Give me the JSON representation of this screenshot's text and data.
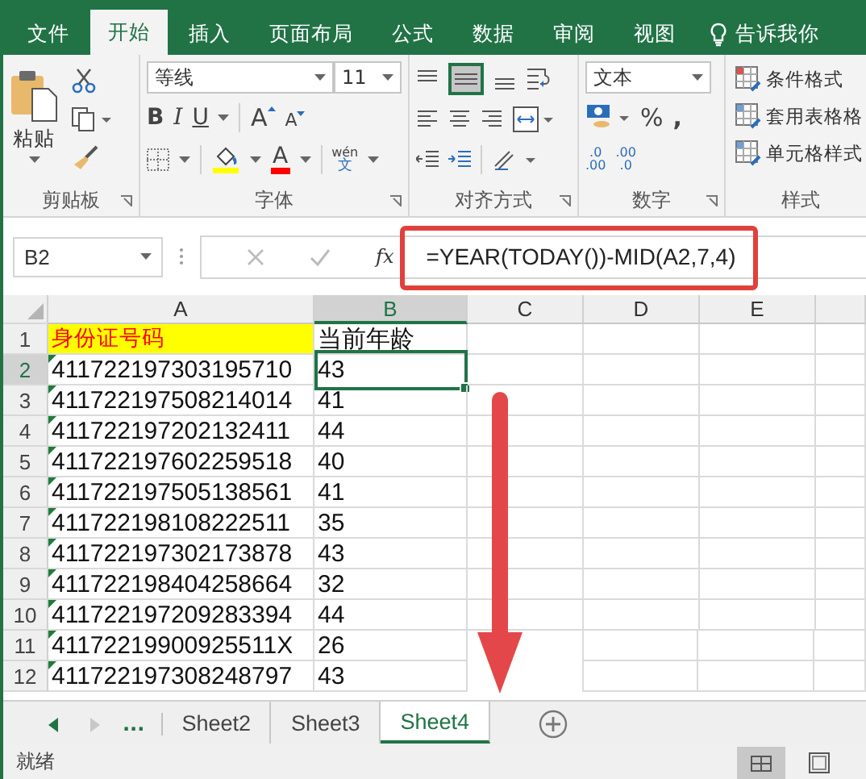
{
  "tabs": [
    {
      "label": "文件",
      "selected": false
    },
    {
      "label": "开始",
      "selected": true
    },
    {
      "label": "插入",
      "selected": false
    },
    {
      "label": "页面布局",
      "selected": false
    },
    {
      "label": "公式",
      "selected": false
    },
    {
      "label": "数据",
      "selected": false
    },
    {
      "label": "审阅",
      "selected": false
    },
    {
      "label": "视图",
      "selected": false
    }
  ],
  "tell_me": "告诉我你",
  "ribbon": {
    "clipboard": {
      "label": "剪贴板",
      "paste": "粘贴"
    },
    "font": {
      "label": "字体",
      "font_name": "等线",
      "font_size": "11",
      "bold": "B",
      "italic": "I",
      "underline": "U",
      "grow": "A",
      "shrink": "A",
      "font_color": "A",
      "phonetic": "wén",
      "phonetic_char": "文"
    },
    "alignment": {
      "label": "对齐方式"
    },
    "number": {
      "label": "数字",
      "format": "文本",
      "percent": "%",
      "comma": ",",
      "increase_decimal": [
        ".0",
        ".00"
      ],
      "decrease_decimal": [
        ".00",
        ".0"
      ]
    },
    "styles": {
      "label": "样式",
      "buttons": [
        "条件格式",
        "套用表格格",
        "单元格样式"
      ]
    }
  },
  "formula_bar": {
    "name_box": "B2",
    "fx": "fx",
    "formula": "=YEAR(TODAY())-MID(A2,7,4)"
  },
  "columns": [
    {
      "label": "A",
      "selected": false
    },
    {
      "label": "B",
      "selected": true
    },
    {
      "label": "C",
      "selected": false
    },
    {
      "label": "D",
      "selected": false
    },
    {
      "label": "E",
      "selected": false
    }
  ],
  "rows": [
    {
      "label": "1",
      "selected": false,
      "kind": "header",
      "cells": [
        {
          "text": "身份证号码",
          "selected": false,
          "text_number": false
        },
        {
          "text": "当前年龄",
          "selected": false,
          "text_number": false
        }
      ]
    },
    {
      "label": "2",
      "selected": true,
      "kind": "data",
      "cells": [
        {
          "text": "411722197303195710",
          "selected": false,
          "text_number": true
        },
        {
          "text": "43",
          "selected": true,
          "text_number": false
        }
      ]
    },
    {
      "label": "3",
      "selected": false,
      "kind": "data",
      "cells": [
        {
          "text": "411722197508214014",
          "selected": false,
          "text_number": true
        },
        {
          "text": "41",
          "selected": false,
          "text_number": false
        }
      ]
    },
    {
      "label": "4",
      "selected": false,
      "kind": "data",
      "cells": [
        {
          "text": "411722197202132411",
          "selected": false,
          "text_number": true
        },
        {
          "text": "44",
          "selected": false,
          "text_number": false
        }
      ]
    },
    {
      "label": "5",
      "selected": false,
      "kind": "data",
      "cells": [
        {
          "text": "411722197602259518",
          "selected": false,
          "text_number": true
        },
        {
          "text": "40",
          "selected": false,
          "text_number": false
        }
      ]
    },
    {
      "label": "6",
      "selected": false,
      "kind": "data",
      "cells": [
        {
          "text": "411722197505138561",
          "selected": false,
          "text_number": true
        },
        {
          "text": "41",
          "selected": false,
          "text_number": false
        }
      ]
    },
    {
      "label": "7",
      "selected": false,
      "kind": "data",
      "cells": [
        {
          "text": "411722198108222511",
          "selected": false,
          "text_number": true
        },
        {
          "text": "35",
          "selected": false,
          "text_number": false
        }
      ]
    },
    {
      "label": "8",
      "selected": false,
      "kind": "data",
      "cells": [
        {
          "text": "411722197302173878",
          "selected": false,
          "text_number": true
        },
        {
          "text": "43",
          "selected": false,
          "text_number": false
        }
      ]
    },
    {
      "label": "9",
      "selected": false,
      "kind": "data",
      "cells": [
        {
          "text": "411722198404258664",
          "selected": false,
          "text_number": true
        },
        {
          "text": "32",
          "selected": false,
          "text_number": false
        }
      ]
    },
    {
      "label": "10",
      "selected": false,
      "kind": "data",
      "cells": [
        {
          "text": "411722197209283394",
          "selected": false,
          "text_number": true
        },
        {
          "text": "44",
          "selected": false,
          "text_number": false
        }
      ]
    },
    {
      "label": "11",
      "selected": false,
      "kind": "data",
      "cells": [
        {
          "text": "41172219900925511X",
          "selected": false,
          "text_number": true
        },
        {
          "text": "26",
          "selected": false,
          "text_number": false
        }
      ]
    },
    {
      "label": "12",
      "selected": false,
      "kind": "data",
      "cells": [
        {
          "text": "411722197308248797",
          "selected": false,
          "text_number": true
        },
        {
          "text": "43",
          "selected": false,
          "text_number": false
        }
      ]
    }
  ],
  "sheet_tabs": {
    "more": "...",
    "tabs": [
      {
        "label": "Sheet2",
        "selected": false
      },
      {
        "label": "Sheet3",
        "selected": false
      },
      {
        "label": "Sheet4",
        "selected": true
      }
    ]
  },
  "status": "就绪"
}
